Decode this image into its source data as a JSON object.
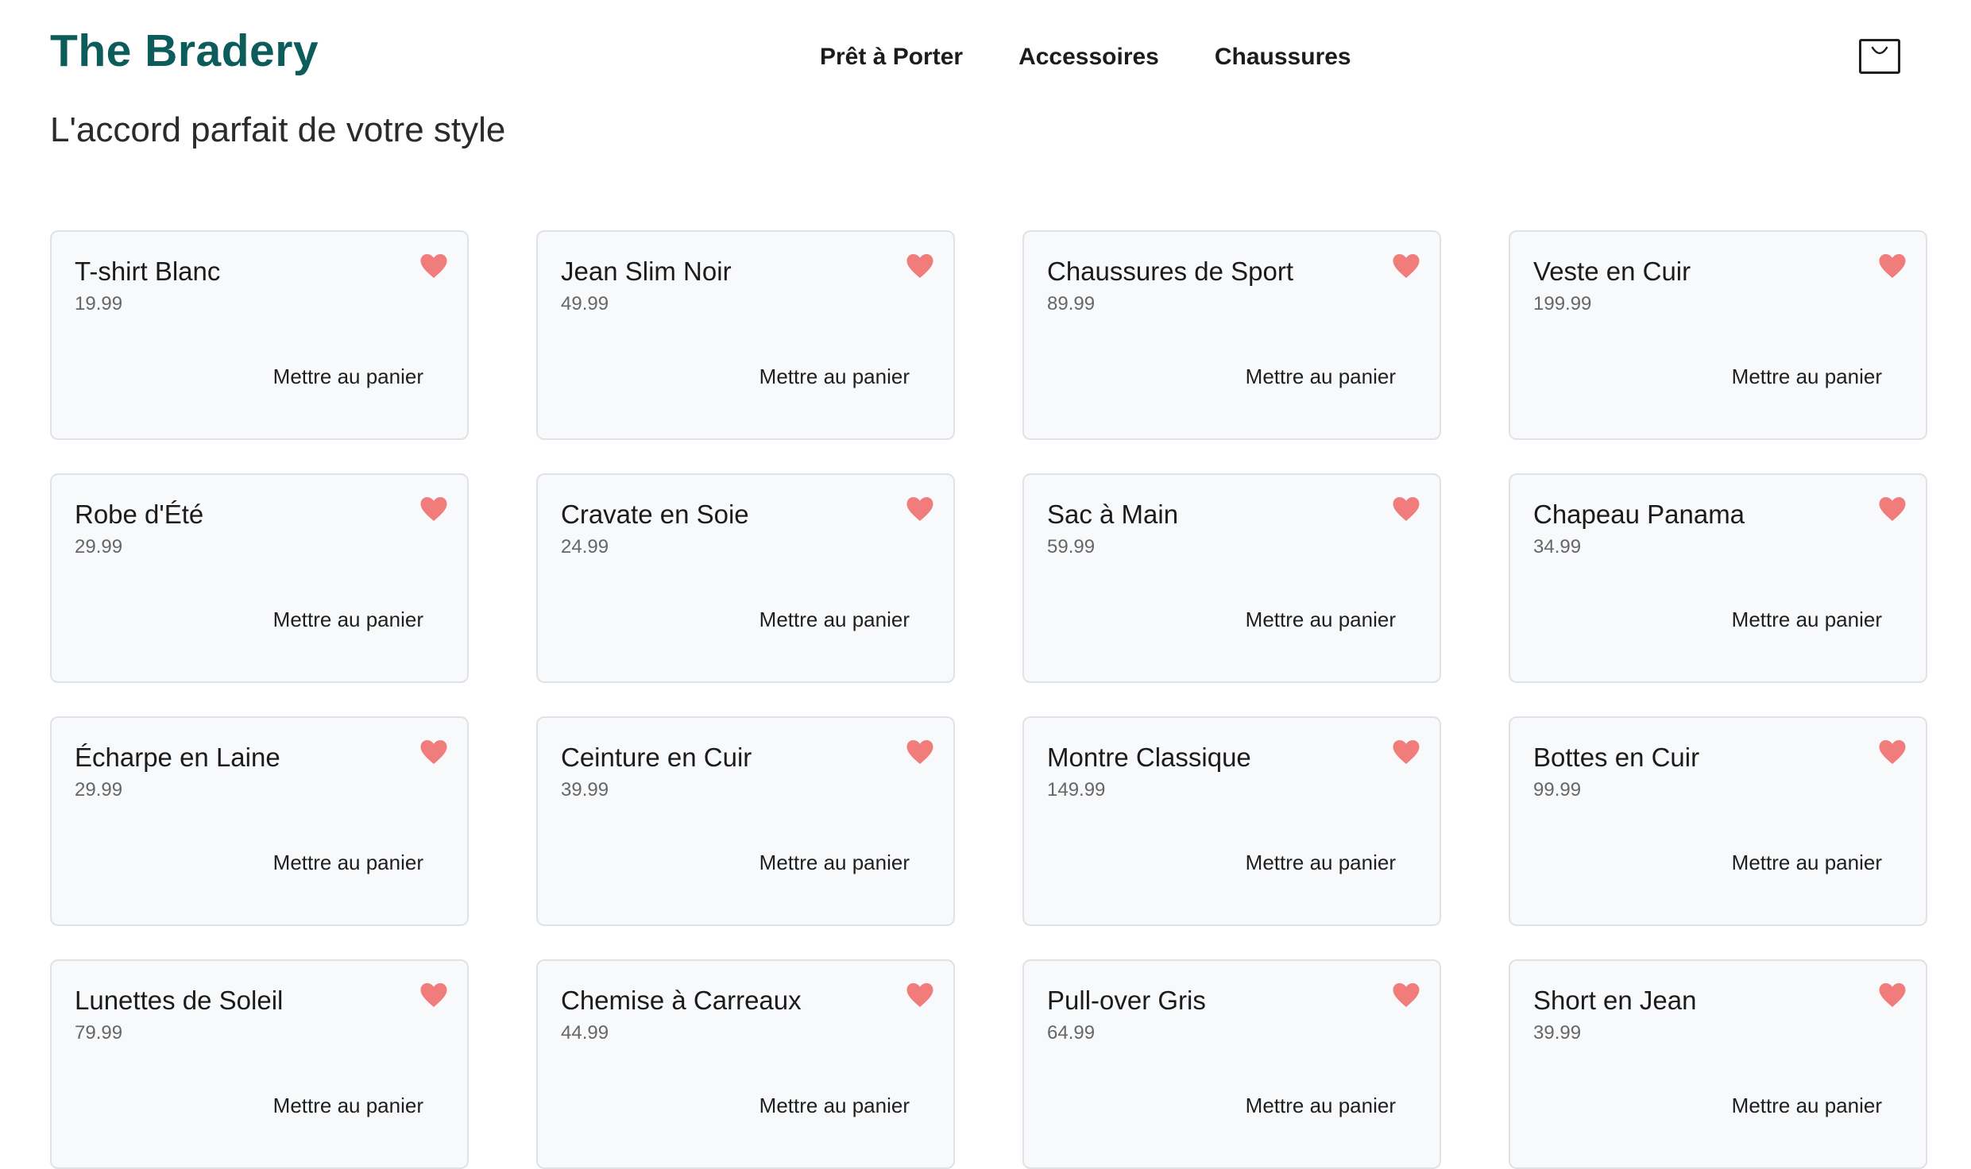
{
  "header": {
    "brand": "The Bradery",
    "nav": [
      "Prêt à Porter",
      "Accessoires",
      "Chaussures"
    ],
    "tagline": "L'accord parfait de votre style"
  },
  "icons": {
    "cart": "shopping-bag-icon",
    "favorite": "heart-icon"
  },
  "colors": {
    "brand": "#0d5c5c",
    "heart": "#f07c7c"
  },
  "add_to_cart_label": "Mettre au panier",
  "products": [
    {
      "name": "T-shirt Blanc",
      "price": "19.99"
    },
    {
      "name": "Jean Slim Noir",
      "price": "49.99"
    },
    {
      "name": "Chaussures de Sport",
      "price": "89.99"
    },
    {
      "name": "Veste en Cuir",
      "price": "199.99"
    },
    {
      "name": "Robe d'Été",
      "price": "29.99"
    },
    {
      "name": "Cravate en Soie",
      "price": "24.99"
    },
    {
      "name": "Sac à Main",
      "price": "59.99"
    },
    {
      "name": "Chapeau Panama",
      "price": "34.99"
    },
    {
      "name": "Écharpe en Laine",
      "price": "29.99"
    },
    {
      "name": "Ceinture en Cuir",
      "price": "39.99"
    },
    {
      "name": "Montre Classique",
      "price": "149.99"
    },
    {
      "name": "Bottes en Cuir",
      "price": "99.99"
    },
    {
      "name": "Lunettes de Soleil",
      "price": "79.99"
    },
    {
      "name": "Chemise à Carreaux",
      "price": "44.99"
    },
    {
      "name": "Pull-over Gris",
      "price": "64.99"
    },
    {
      "name": "Short en Jean",
      "price": "39.99"
    }
  ]
}
